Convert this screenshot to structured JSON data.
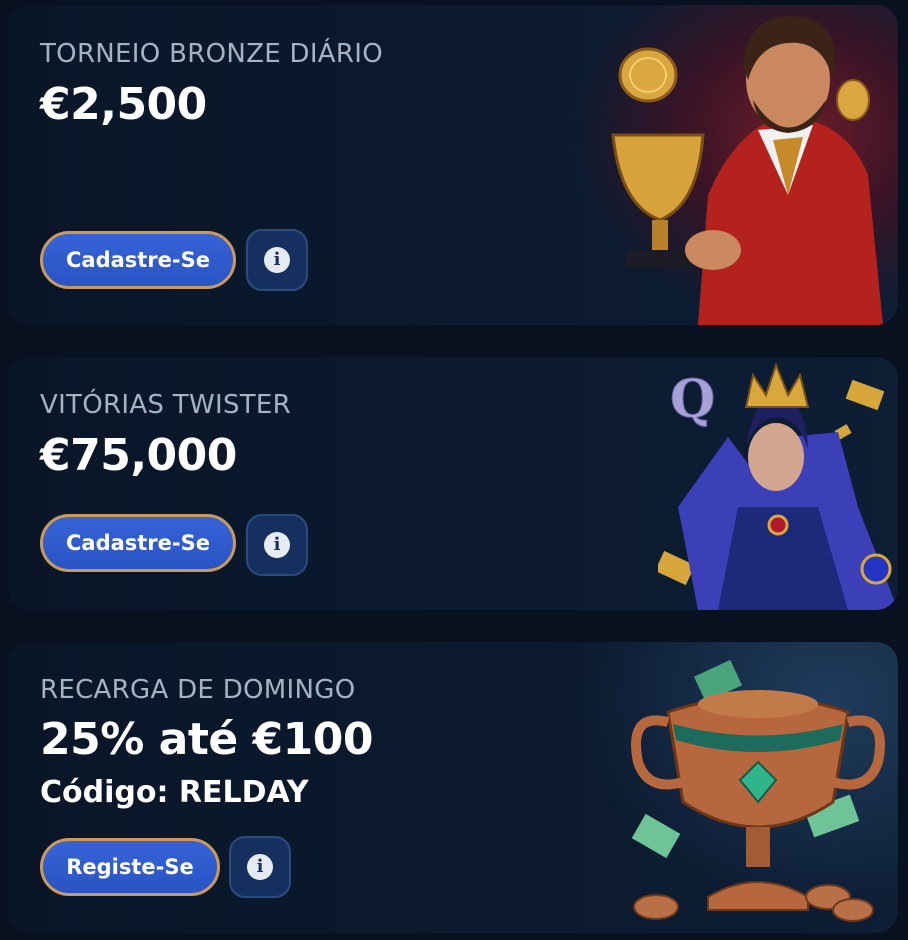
{
  "promos": [
    {
      "subtitle": "TORNEIO BRONZE DIÁRIO",
      "amount": "€2,500",
      "button_label": "Cadastre-Se",
      "info_icon": "i"
    },
    {
      "subtitle": "VITÓRIAS TWISTER",
      "amount": "€75,000",
      "button_label": "Cadastre-Se",
      "info_icon": "i",
      "art_letter": "Q"
    },
    {
      "subtitle": "RECARGA DE DOMINGO",
      "amount": "25% até €100",
      "code": "Código: RELDAY",
      "button_label": "Registe-Se",
      "info_icon": "i"
    }
  ],
  "colors": {
    "background": "#07111f",
    "card": "#0b1a2e",
    "button": "#2f5bd0",
    "button_border": "#c99a5b",
    "info_button": "#15305e",
    "subtitle": "#a7b3c4"
  }
}
